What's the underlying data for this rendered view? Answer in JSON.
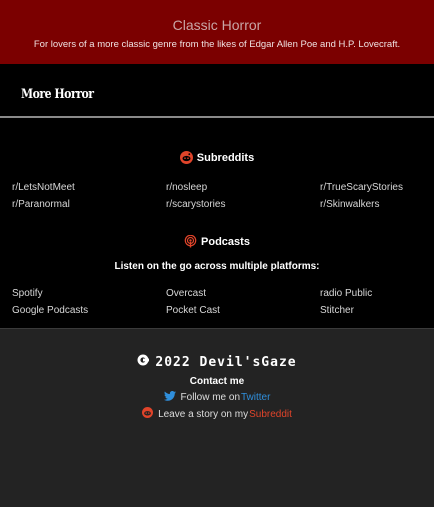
{
  "banner": {
    "title": "Classic Horror",
    "subtitle": "For lovers of a more classic genre from the likes of Edgar Allen Poe and H.P. Lovecraft."
  },
  "nav": {
    "brand": "More Horror"
  },
  "subreddits": {
    "heading": "Subreddits",
    "icon": "reddit-icon",
    "links": [
      "r/LetsNotMeet",
      "r/nosleep",
      "r/TrueScaryStories",
      "r/Paranormal",
      "r/scarystories",
      "r/Skinwalkers"
    ]
  },
  "podcasts": {
    "heading": "Podcasts",
    "icon": "podcast-icon",
    "intro": "Listen on the go across multiple platforms:",
    "links": [
      "Spotify",
      "Overcast",
      "radio Public",
      "Google Podcasts",
      "Pocket Cast",
      "Stitcher"
    ]
  },
  "footer": {
    "copyright": "2022 Devil'sGaze",
    "contact_heading": "Contact me",
    "twitter_prefix": "Follow me on ",
    "twitter_link": "Twitter",
    "reddit_prefix": "Leave a story on my ",
    "reddit_link": "Subreddit"
  },
  "colors": {
    "banner_bg": "#7b0000",
    "accent_red": "#e0442a",
    "twitter_blue": "#2f8fdc"
  }
}
